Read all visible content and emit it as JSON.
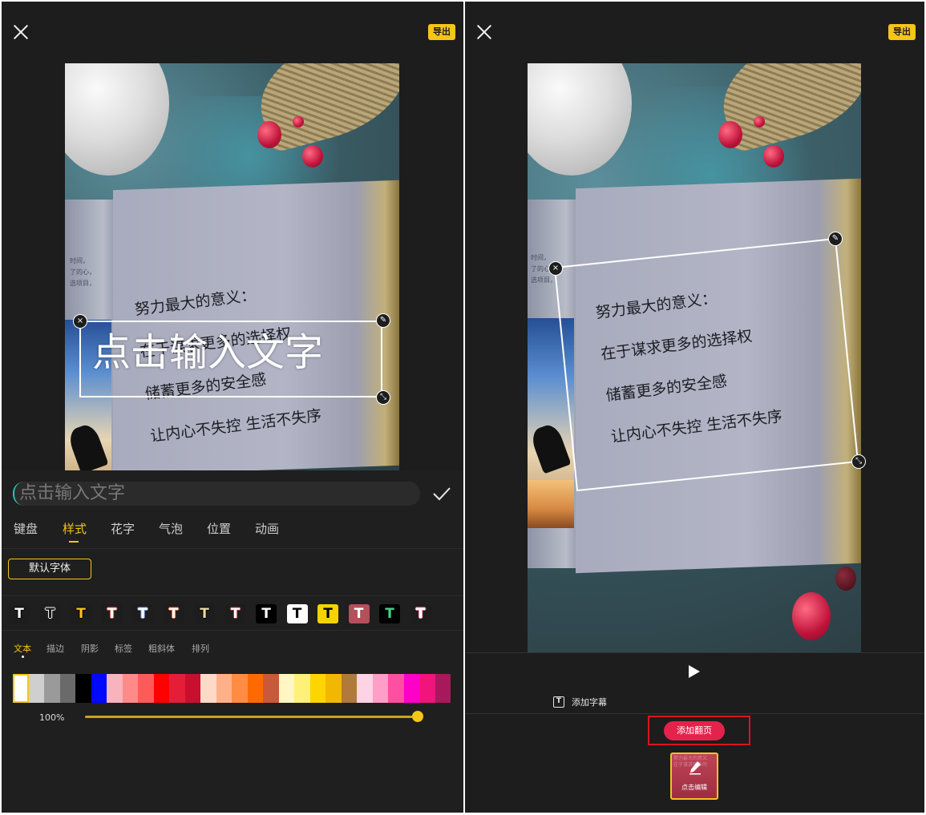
{
  "left": {
    "export_label": "导出",
    "poem_lines": [
      "努力最大的意义：",
      "在于谋求更多的选择权",
      "储蓄更多的安全感",
      "让内心不失控 生活不失序"
    ],
    "book_side_text": [
      "时间，",
      "了的心，",
      "选项目，"
    ],
    "overlay_text": "点击输入文字",
    "input_placeholder": "点击输入文字",
    "tabs": [
      "键盘",
      "样式",
      "花字",
      "气泡",
      "位置",
      "动画"
    ],
    "active_tab": "样式",
    "font_button": "默认字体",
    "text_styles": [
      {
        "glyph": "T",
        "fg": "#ffffff",
        "bg": "#1d1d1d",
        "stroke": "#000000"
      },
      {
        "glyph": "T",
        "fg": "#1d1d1d",
        "bg": "#1d1d1d",
        "stroke": "#ffffff"
      },
      {
        "glyph": "T",
        "fg": "#f5c518",
        "bg": "#1d1d1d",
        "stroke": "#000000"
      },
      {
        "glyph": "T",
        "fg": "#ffffff",
        "bg": "#1d1d1d",
        "stroke": "#e0524f"
      },
      {
        "glyph": "T",
        "fg": "#ffffff",
        "bg": "#1d1d1d",
        "stroke": "#7aa6e8"
      },
      {
        "glyph": "T",
        "fg": "#ffffff",
        "bg": "#1d1d1d",
        "stroke": "#e0652a"
      },
      {
        "glyph": "T",
        "fg": "#e8d9a0",
        "bg": "#1d1d1d",
        "stroke": "#000000"
      },
      {
        "glyph": "T",
        "fg": "#ffffff",
        "bg": "#1d1d1d",
        "stroke": "#b0393c"
      },
      {
        "glyph": "T",
        "fg": "#ffffff",
        "bg": "#000000",
        "stroke": "#000000"
      },
      {
        "glyph": "T",
        "fg": "#000000",
        "bg": "#ffffff",
        "stroke": "#ffffff"
      },
      {
        "glyph": "T",
        "fg": "#000000",
        "bg": "#f5d300",
        "stroke": "#f5d300"
      },
      {
        "glyph": "T",
        "fg": "#ffffff",
        "bg": "#b2505b",
        "stroke": "#b2505b"
      },
      {
        "glyph": "T",
        "fg": "#44d18a",
        "bg": "#000000",
        "stroke": "#000000"
      },
      {
        "glyph": "T",
        "fg": "#ffffff",
        "bg": "#1d1d1d",
        "stroke": "#ff8fb1"
      }
    ],
    "subtabs": [
      "文本",
      "描边",
      "阴影",
      "标签",
      "粗斜体",
      "排列"
    ],
    "active_subtab": "文本",
    "colors": [
      "#ffffff",
      "#cfcfcf",
      "#9a9a9a",
      "#6a6a6a",
      "#000000",
      "#0008ff",
      "#f7b4bd",
      "#ff8a87",
      "#ff5a5a",
      "#ff0000",
      "#e51e37",
      "#c8102e",
      "#ffd9c7",
      "#ffb088",
      "#ff8c42",
      "#ff6a00",
      "#c8593a",
      "#fff6c2",
      "#fff07a",
      "#ffd500",
      "#f2b700",
      "#b07a3a",
      "#ffd3e6",
      "#ff9ec7",
      "#ff4fa0",
      "#ff00c8",
      "#f0147c",
      "#a8195b"
    ],
    "opacity_label": "100%",
    "opacity_value": 1.0
  },
  "right": {
    "export_label": "导出",
    "poem_lines": [
      "努力最大的意义：",
      "在于谋求更多的选择权",
      "储蓄更多的安全感",
      "让内心不失控 生活不失序"
    ],
    "book_side_text": [
      "时间，",
      "了的心，",
      "选项目，"
    ],
    "add_subtitle_label": "添加字幕",
    "add_page_label": "添加翻页",
    "thumb_label": "点击编辑",
    "thumb_faint_text": [
      "努力最大的意义",
      "在于谋求更多的"
    ]
  }
}
